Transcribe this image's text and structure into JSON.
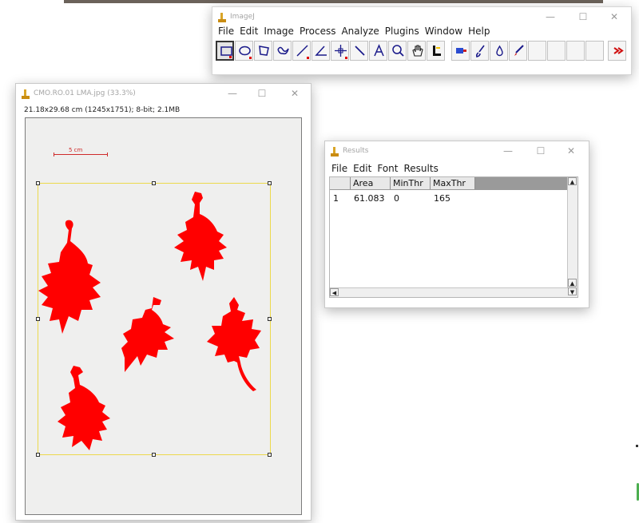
{
  "imagej": {
    "title": "ImageJ",
    "menu": [
      "File",
      "Edit",
      "Image",
      "Process",
      "Analyze",
      "Plugins",
      "Window",
      "Help"
    ],
    "tools": [
      "rectangle-tool",
      "oval-tool",
      "polygon-tool",
      "freehand-tool",
      "line-tool",
      "angle-tool",
      "multipoint-tool",
      "wand-tool",
      "text-tool",
      "magnifier-tool",
      "hand-tool",
      "dropper-tool",
      "custom-macro-tool",
      "brush-tool",
      "flood-fill-tool",
      "pencil-tool",
      "more-tools"
    ]
  },
  "image_window": {
    "title": "CMO.RO.01 LMA.jpg (33.3%)",
    "info": "21.18x29.68 cm (1245x1751); 8-bit; 2.1MB",
    "scale_label": "5 cm",
    "leaf_color": "#ff0000"
  },
  "results": {
    "title": "Results",
    "menu": [
      "File",
      "Edit",
      "Font",
      "Results"
    ],
    "columns": [
      "",
      "Area",
      "MinThr",
      "MaxThr"
    ],
    "rows": [
      [
        "1",
        "61.083",
        "0",
        "165"
      ]
    ]
  },
  "window_controls": {
    "minimize": "—",
    "maximize": "☐",
    "close": "✕"
  }
}
